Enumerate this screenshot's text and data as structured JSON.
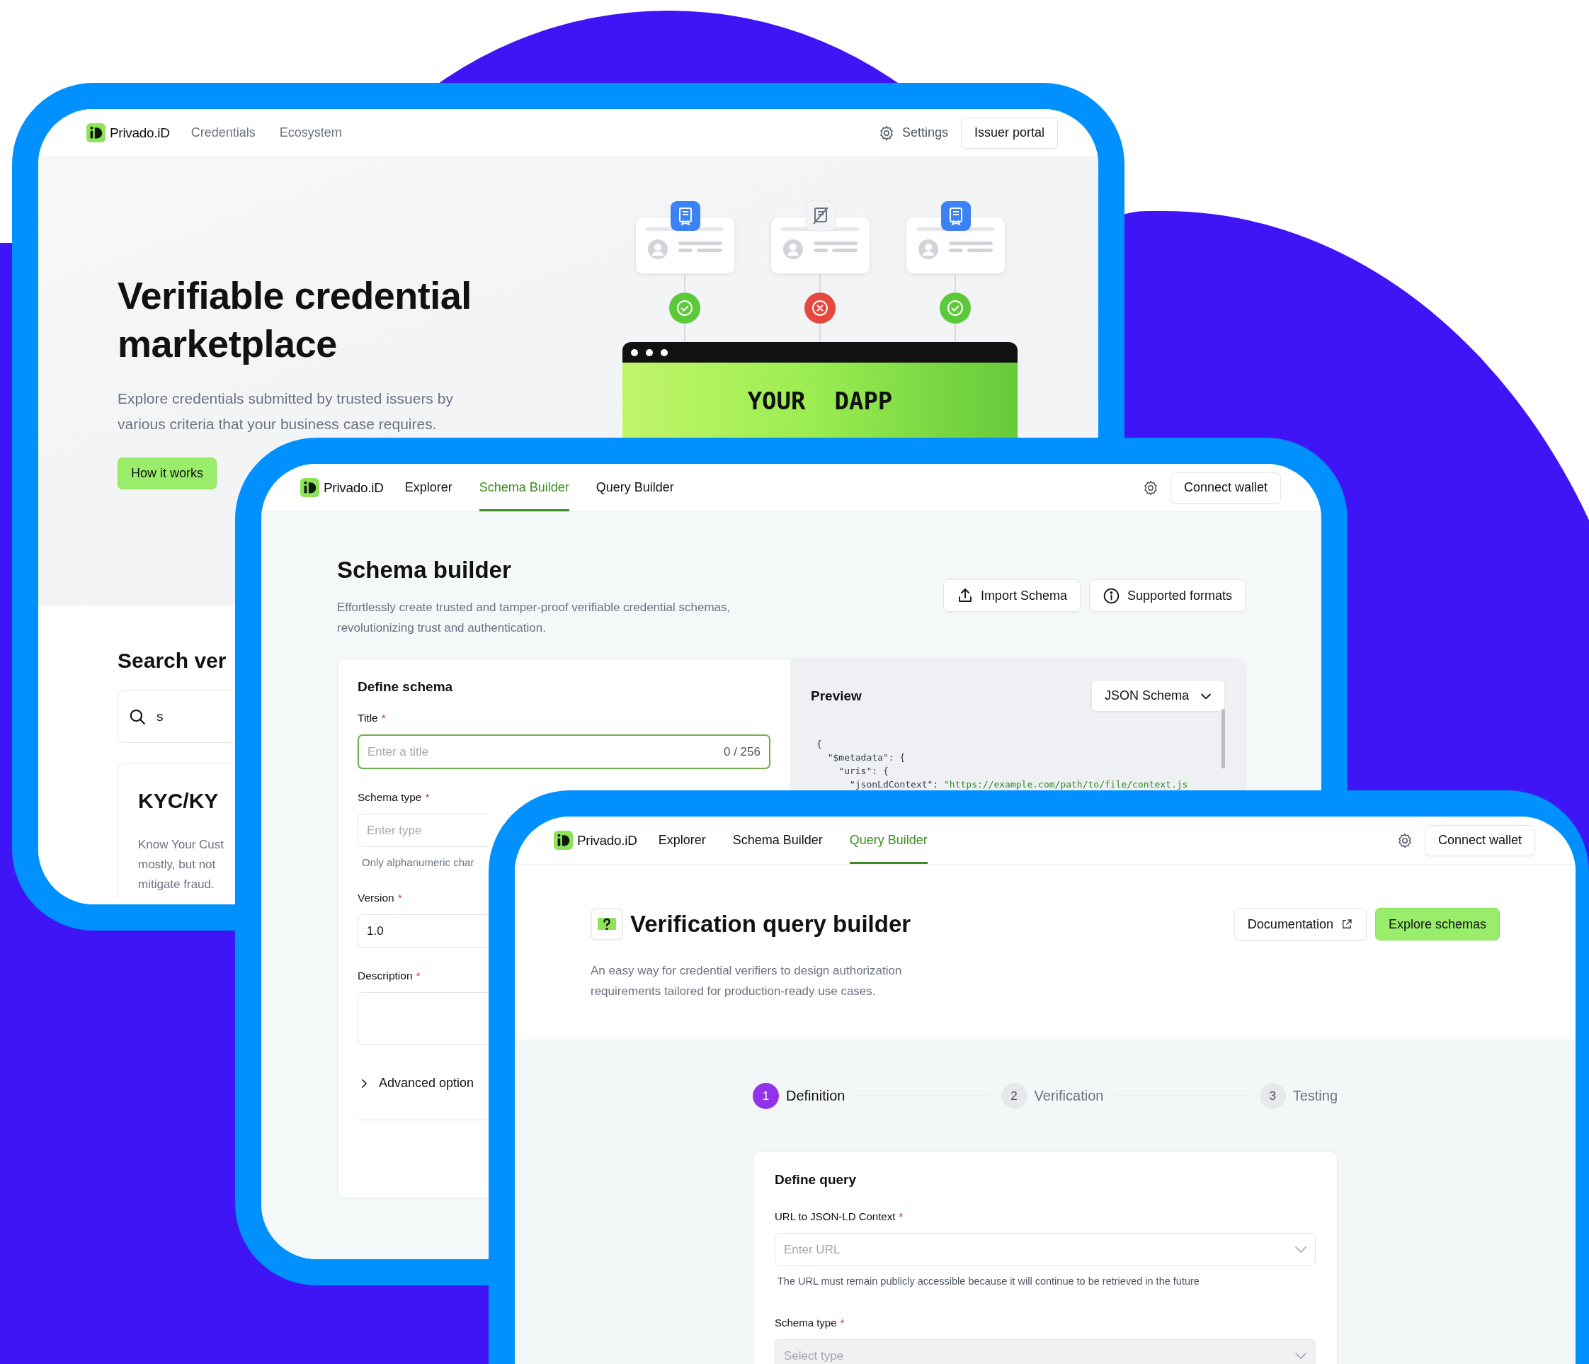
{
  "windows": [
    {
      "kind": "marketplace",
      "nav": {
        "brand": "Privado.iD",
        "links": [
          {
            "label": "Credentials",
            "selected": false
          },
          {
            "label": "Ecosystem",
            "selected": false
          }
        ],
        "settings_label": "Settings",
        "action": "Issuer portal"
      },
      "hero": {
        "title": "Verifiable credential marketplace",
        "subtitle": "Explore credentials submitted by trusted issuers by various criteria that your business case requires.",
        "button": "How it works",
        "credentials": [
          {
            "verified": true
          },
          {
            "verified": false
          },
          {
            "verified": true
          }
        ],
        "dapp_label": "YOUR  DAPP"
      },
      "search": {
        "heading": "Search ver",
        "value": "s"
      },
      "card": {
        "title": "KYC/KY",
        "lines": [
          "Know Your Cust",
          "mostly, but not",
          "mitigate fraud."
        ]
      }
    },
    {
      "kind": "schema_builder",
      "nav": {
        "brand": "Privado.iD",
        "links": [
          {
            "label": "Explorer",
            "selected": false
          },
          {
            "label": "Schema Builder",
            "selected": true
          },
          {
            "label": "Query Builder",
            "selected": false
          }
        ],
        "action": "Connect wallet"
      },
      "title": "Schema builder",
      "description": "Effortlessly create trusted and tamper-proof verifiable credential schemas, revolutionizing trust and authentication.",
      "buttons": [
        {
          "label": "Import Schema",
          "kind": "upload"
        },
        {
          "label": "Supported formats",
          "kind": "info"
        }
      ],
      "form": {
        "title": "Define schema",
        "fields": [
          {
            "kind": "counter",
            "label": "Title",
            "asterisk": "*",
            "placeholder": "Enter a title",
            "counter": "0 / 256",
            "focused": true
          },
          {
            "kind": "text",
            "label": "Schema type",
            "asterisk": "*",
            "placeholder": "Enter type",
            "helper": "Only alphanumeric char",
            "focused": false
          },
          {
            "kind": "text",
            "label": "Version",
            "asterisk": "*",
            "value": "1.0",
            "focused": false
          },
          {
            "kind": "textarea",
            "label": "Description",
            "asterisk": "*",
            "focused": false
          }
        ],
        "advanced": {
          "label": "Advanced option",
          "expanded": false
        }
      },
      "preview": {
        "title": "Preview",
        "format": "JSON Schema",
        "code": [
          {
            "text": "{"
          },
          {
            "text": "  \"$metadata\": {"
          },
          {
            "text": "    \"uris\": {"
          },
          {
            "text": "      \"jsonLdContext\": ",
            "string": "\"https://example.com/path/to/file/context.js"
          }
        ]
      }
    },
    {
      "kind": "query_builder",
      "nav": {
        "brand": "Privado.iD",
        "links": [
          {
            "label": "Explorer",
            "selected": false
          },
          {
            "label": "Schema Builder",
            "selected": false
          },
          {
            "label": "Query Builder",
            "selected": true
          }
        ],
        "action": "Connect wallet"
      },
      "title": "Verification query builder",
      "description": "An easy way for credential verifiers to design authorization requirements tailored for production-ready use cases.",
      "buttons": [
        {
          "label": "Documentation",
          "kind": "external"
        },
        {
          "label": "Explore schemas",
          "kind": "primary"
        }
      ],
      "steps": [
        {
          "number": "1",
          "label": "Definition",
          "selected": true
        },
        {
          "number": "2",
          "label": "Verification",
          "selected": false
        },
        {
          "number": "3",
          "label": "Testing",
          "selected": false
        }
      ],
      "card": {
        "title": "Define query",
        "fields": [
          {
            "label": "URL to JSON-LD Context",
            "asterisk": "*",
            "placeholder": "Enter URL",
            "helper": "The URL must remain publicly accessible because it will continue to be retrieved in the future",
            "disabled": false
          },
          {
            "label": "Schema type",
            "asterisk": "*",
            "placeholder": "Select type",
            "disabled": true
          }
        ]
      }
    }
  ]
}
